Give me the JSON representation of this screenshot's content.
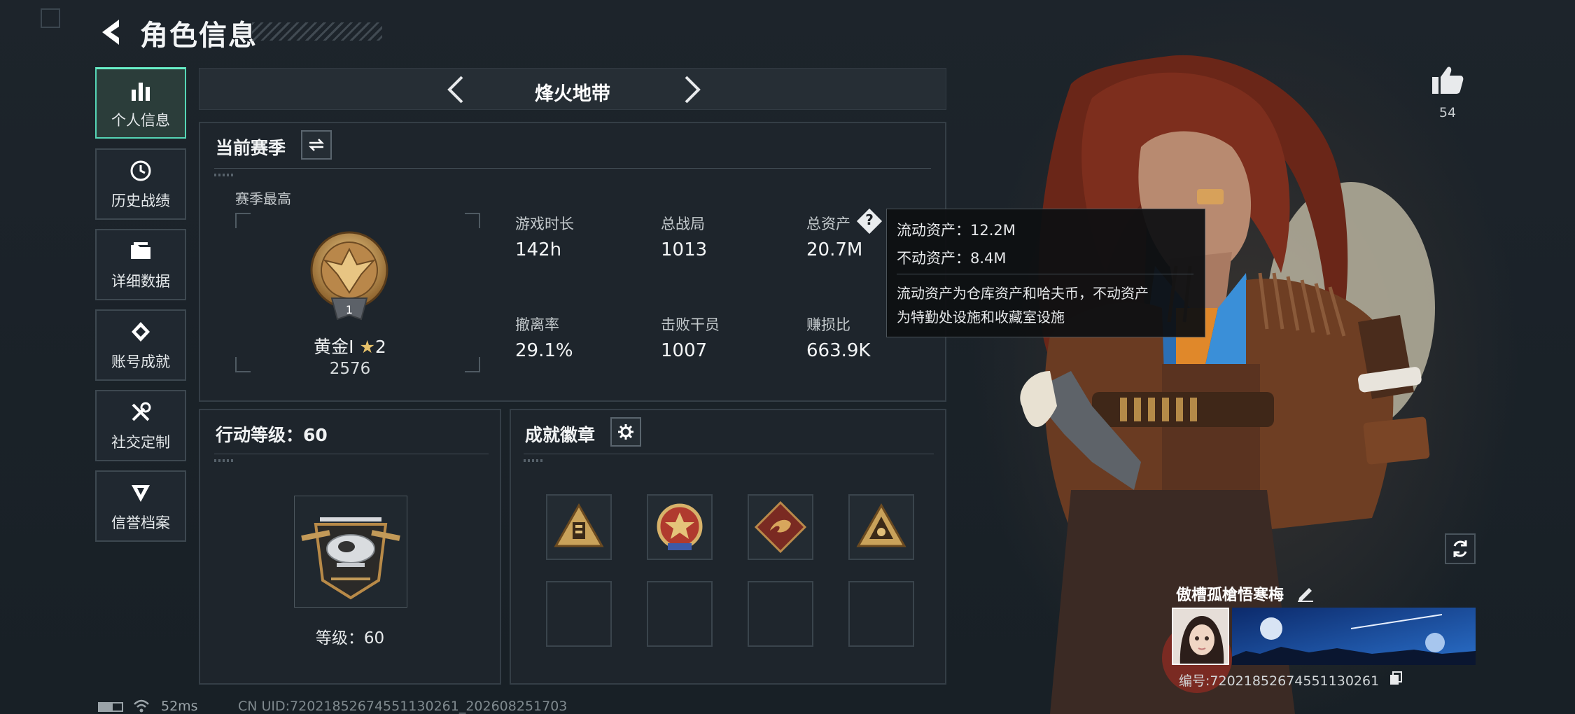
{
  "header": {
    "title": "角色信息"
  },
  "sidebar": {
    "items": [
      {
        "label": "个人信息",
        "active": true
      },
      {
        "label": "历史战绩",
        "active": false
      },
      {
        "label": "详细数据",
        "active": false
      },
      {
        "label": "账号成就",
        "active": false
      },
      {
        "label": "社交定制",
        "active": false
      },
      {
        "label": "信誉档案",
        "active": false
      }
    ]
  },
  "mode_bar": {
    "name": "烽火地带"
  },
  "season": {
    "title": "当前赛季",
    "best_label": "赛季最高",
    "rank_name": "黄金I",
    "rank_stars": "2",
    "rank_score": "2576",
    "rank_badge_text": "1",
    "stats": [
      {
        "label": "游戏时长",
        "value": "142h"
      },
      {
        "label": "总战局",
        "value": "1013"
      },
      {
        "label": "总资产",
        "value": "20.7M"
      },
      {
        "label": "撤离率",
        "value": "29.1%"
      },
      {
        "label": "击败干员",
        "value": "1007"
      },
      {
        "label": "赚损比",
        "value": "663.9K"
      }
    ],
    "help_icon_text": "?"
  },
  "tooltip": {
    "line1": "流动资产：12.2M",
    "line2": "不动资产：8.4M",
    "desc1": "流动资产为仓库资产和哈夫币，不动资产",
    "desc2": "为特勤处设施和收藏室设施"
  },
  "action_level": {
    "title": "行动等级：60",
    "level_text": "等级：60"
  },
  "achievements": {
    "title": "成就徽章",
    "badges": [
      "triangle-badge",
      "star-shield-badge",
      "dragon-diamond-badge",
      "triangle-eye-badge"
    ]
  },
  "character": {
    "likes": "54",
    "nickname": "傲槽孤槍悟寒梅",
    "uid_label": "编号:720218526745511302​61"
  },
  "status": {
    "ping": "52ms",
    "uid_line": "CN UID:720218526745511302​61_202608251703"
  },
  "colors": {
    "accent": "#5ee6c0",
    "panel": "#1e252c",
    "gold": "#c79b52"
  }
}
